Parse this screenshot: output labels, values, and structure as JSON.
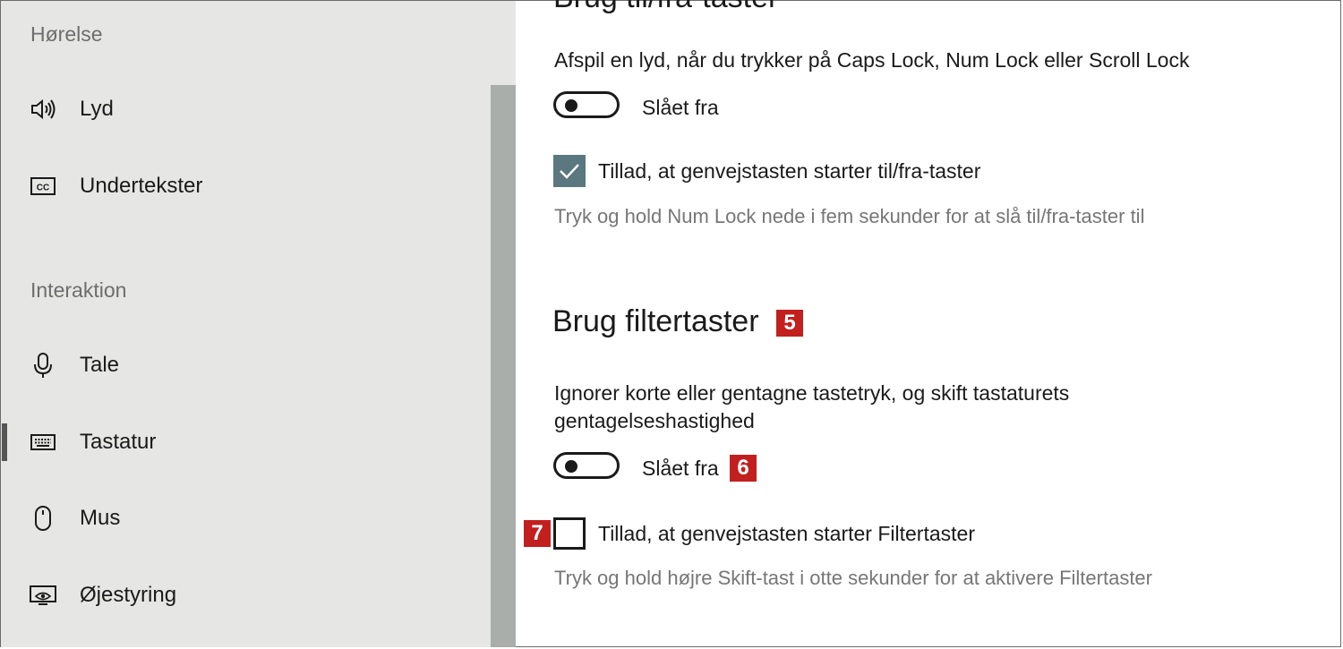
{
  "sidebar": {
    "section_hearing": "Hørelse",
    "section_interaction": "Interaktion",
    "items": [
      {
        "label": "Lyd",
        "icon": "speaker-icon"
      },
      {
        "label": "Undertekster",
        "icon": "closed-captions-icon"
      },
      {
        "label": "Tale",
        "icon": "microphone-icon"
      },
      {
        "label": "Tastatur",
        "icon": "keyboard-icon",
        "active": true
      },
      {
        "label": "Mus",
        "icon": "mouse-icon"
      },
      {
        "label": "Øjestyring",
        "icon": "eye-control-icon"
      }
    ]
  },
  "main": {
    "toggle_keys": {
      "heading": "Brug til/fra-taster",
      "sound_label": "Afspil en lyd, når du trykker på Caps Lock, Num Lock eller Scroll Lock",
      "toggle_state": "Slået fra",
      "shortcut_label": "Tillad, at genvejstasten starter til/fra-taster",
      "shortcut_checked": true,
      "shortcut_hint": "Tryk og hold Num Lock nede i fem sekunder for at slå til/fra-taster til"
    },
    "filter_keys": {
      "heading": "Brug filtertaster",
      "description_line1": "Ignorer korte eller gentagne tastetryk, og skift tastaturets",
      "description_line2": "gentagelseshastighed",
      "toggle_state": "Slået fra",
      "shortcut_label": "Tillad, at genvejstasten starter Filtertaster",
      "shortcut_checked": false,
      "shortcut_hint": "Tryk og hold højre Skift-tast i otte sekunder for at aktivere Filtertaster"
    },
    "badges": {
      "b5": "5",
      "b6": "6",
      "b7": "7"
    }
  },
  "colors": {
    "sidebar_bg": "#e6e6e4",
    "scrollbar": "#a9aeab",
    "checkbox_checked": "#5b7780",
    "badge_red": "#c21f1f"
  }
}
